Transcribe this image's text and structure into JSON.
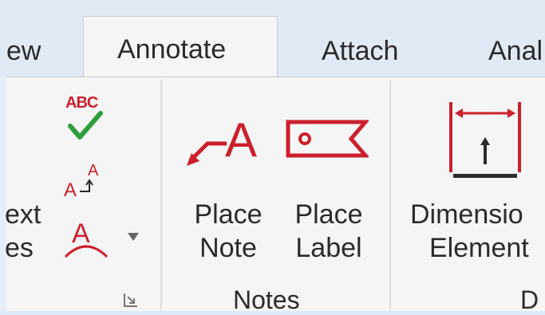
{
  "tabs": [
    {
      "label": "ew"
    },
    {
      "label": "Annotate",
      "active": true
    },
    {
      "label": "Attach"
    },
    {
      "label": "Anal"
    }
  ],
  "text_group": {
    "label_line1": "ext",
    "label_line2": "es",
    "spell_icon_text": "ABC",
    "launcher_icon": "dialog-launcher-icon"
  },
  "notes_group": {
    "place_note": {
      "line1": "Place",
      "line2": "Note"
    },
    "place_label": {
      "line1": "Place",
      "line2": "Label"
    },
    "group_label": "Notes"
  },
  "dimension_group": {
    "button": {
      "line1": "Dimensio",
      "line2": "Element"
    },
    "group_label": "D"
  },
  "colors": {
    "accent_red": "#cc1f2d",
    "check_green": "#2e9e3c",
    "background": "#f5f5f5"
  }
}
